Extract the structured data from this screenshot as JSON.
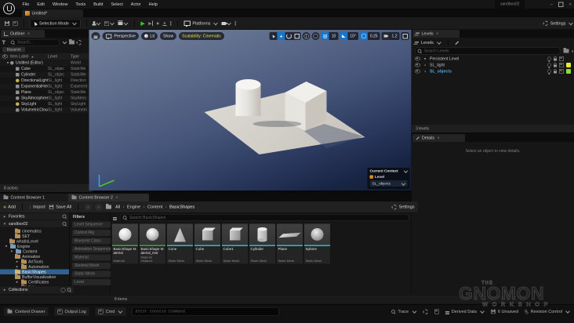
{
  "window": {
    "app_title": "sandbox02",
    "menus": [
      "File",
      "Edit",
      "Window",
      "Tools",
      "Build",
      "Select",
      "Actor",
      "Help"
    ],
    "doc_tab": "Untitled*"
  },
  "toolbar": {
    "selection_mode": "Selection Mode",
    "platforms": "Platforms",
    "settings": "Settings"
  },
  "outliner": {
    "tab": "Outliner",
    "search_placeholder": "Search...",
    "filter_chip": "Blueprint",
    "columns": {
      "label": "Item Label",
      "level": "Level",
      "type": "Type"
    },
    "rows": [
      {
        "label": "Untitled (Editor)",
        "level": "",
        "type": "World"
      },
      {
        "label": "Cube",
        "level": "SL_objec",
        "type": "StaticMe"
      },
      {
        "label": "Cylinder",
        "level": "SL_objec",
        "type": "StaticMe"
      },
      {
        "label": "DirectionalLight",
        "level": "SL_light",
        "type": "Direction"
      },
      {
        "label": "ExponentialHeigh",
        "level": "SL_light",
        "type": "Exponent"
      },
      {
        "label": "Plane",
        "level": "SL_objec",
        "type": "StaticMe"
      },
      {
        "label": "SkyAtmosphere",
        "level": "SL_light",
        "type": "SkyAtmo"
      },
      {
        "label": "SkyLight",
        "level": "SL_light",
        "type": "SkyLight"
      },
      {
        "label": "VolumetricCloud",
        "level": "SL_light",
        "type": "Volumetri"
      }
    ],
    "footer": "8 actors"
  },
  "viewport": {
    "perspective": "Perspective",
    "lit": "Lit",
    "show": "Show",
    "scalability": "Scalability: Cinematic",
    "snap_grid": "10",
    "snap_angle": "10°",
    "snap_scale": "0.25",
    "camera_speed": "1.2",
    "context": {
      "title": "Current Context",
      "level_label": "Level",
      "level_value": "SL_objects"
    }
  },
  "levels": {
    "tab": "Levels",
    "menu_button": "Levels",
    "search_placeholder": "Search Levels",
    "rows": [
      {
        "name": "Persistent Level"
      },
      {
        "name": "SL_light"
      },
      {
        "name": "SL_objects"
      }
    ],
    "footer": "3 levels"
  },
  "details": {
    "tab": "Details",
    "empty_message": "Select an object to view details."
  },
  "content_browser": {
    "tab1": "Content Browser 1",
    "tab2": "Content Browser 2",
    "add": "Add",
    "import": "Import",
    "save_all": "Save All",
    "settings": "Settings",
    "breadcrumbs": [
      "All",
      "Engine",
      "Content",
      "BasicShapes"
    ],
    "favorites": "Favorites",
    "project": "sandbox02",
    "collections": "Collections",
    "tree": [
      {
        "name": "cinematics"
      },
      {
        "name": "SET"
      },
      {
        "name": "whatIsLevel"
      },
      {
        "name": "Engine"
      },
      {
        "name": "Content"
      },
      {
        "name": "Animation"
      },
      {
        "name": "ArtTools"
      },
      {
        "name": "Automation"
      },
      {
        "name": "BasicShapes"
      },
      {
        "name": "BufferVisualization"
      },
      {
        "name": "Certificates"
      },
      {
        "name": "Editor"
      }
    ],
    "filters_title": "Filters",
    "filters": [
      "Level Sequence",
      "Control Rig",
      "Blueprint Class",
      "Animation Sequence",
      "Material",
      "Skeletal Mesh",
      "Static Mesh",
      "Level"
    ],
    "search_placeholder": "Search BasicShapes",
    "assets": [
      {
        "name": "BasicShape Material",
        "type": "Material"
      },
      {
        "name": "BasicShape Material_Inst",
        "type": "Material Instance"
      },
      {
        "name": "Cone",
        "type": "Static Mesh"
      },
      {
        "name": "Cube",
        "type": "Static Mesh"
      },
      {
        "name": "Cube1",
        "type": "Static Mesh"
      },
      {
        "name": "Cylinder",
        "type": "Static Mesh"
      },
      {
        "name": "Plane",
        "type": "Static Mesh"
      },
      {
        "name": "Sphere",
        "type": "Static Mesh"
      }
    ],
    "footer": "8 items"
  },
  "status_bar": {
    "content_drawer": "Content Drawer",
    "output_log": "Output Log",
    "cmd": "Cmd",
    "console_placeholder": "Enter Console Command",
    "trace": "Trace",
    "derived_data": "Derived Data",
    "unsaved": "6 Unsaved",
    "revision_control": "Revision Control"
  },
  "watermark": {
    "the": "THE",
    "name": "GNOMON",
    "sub": "WORKSHOP"
  },
  "colors": {
    "accent_material": "#3fa33f",
    "accent_static_mesh": "#1cc2d4",
    "chip_yellow": "#e4e83a",
    "chip_green": "#85e02d"
  }
}
